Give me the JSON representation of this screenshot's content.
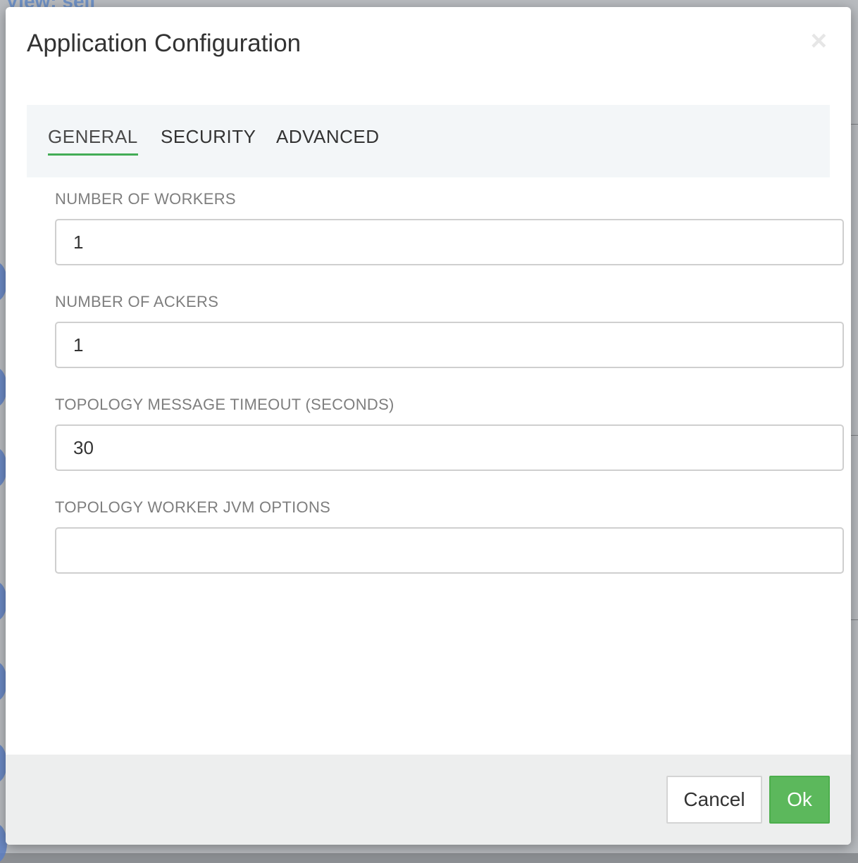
{
  "background": {
    "view_title": "View: sell"
  },
  "modal": {
    "title": "Application Configuration",
    "close_glyph": "×",
    "tabs": [
      {
        "label": "GENERAL",
        "active": true
      },
      {
        "label": "SECURITY",
        "active": false
      },
      {
        "label": "ADVANCED",
        "active": false
      }
    ],
    "fields": [
      {
        "label": "NUMBER OF WORKERS",
        "value": "1",
        "placeholder": ""
      },
      {
        "label": "NUMBER OF ACKERS",
        "value": "1",
        "placeholder": ""
      },
      {
        "label": "TOPOLOGY MESSAGE TIMEOUT (SECONDS)",
        "value": "30",
        "placeholder": ""
      },
      {
        "label": "TOPOLOGY WORKER JVM OPTIONS",
        "value": "",
        "placeholder": ""
      }
    ],
    "footer": {
      "cancel_label": "Cancel",
      "ok_label": "Ok"
    }
  },
  "colors": {
    "accent_green": "#43ac56",
    "ok_button": "#5cb85c",
    "tab_bar_bg": "#f3f6f8",
    "footer_bg": "#edeeee"
  }
}
